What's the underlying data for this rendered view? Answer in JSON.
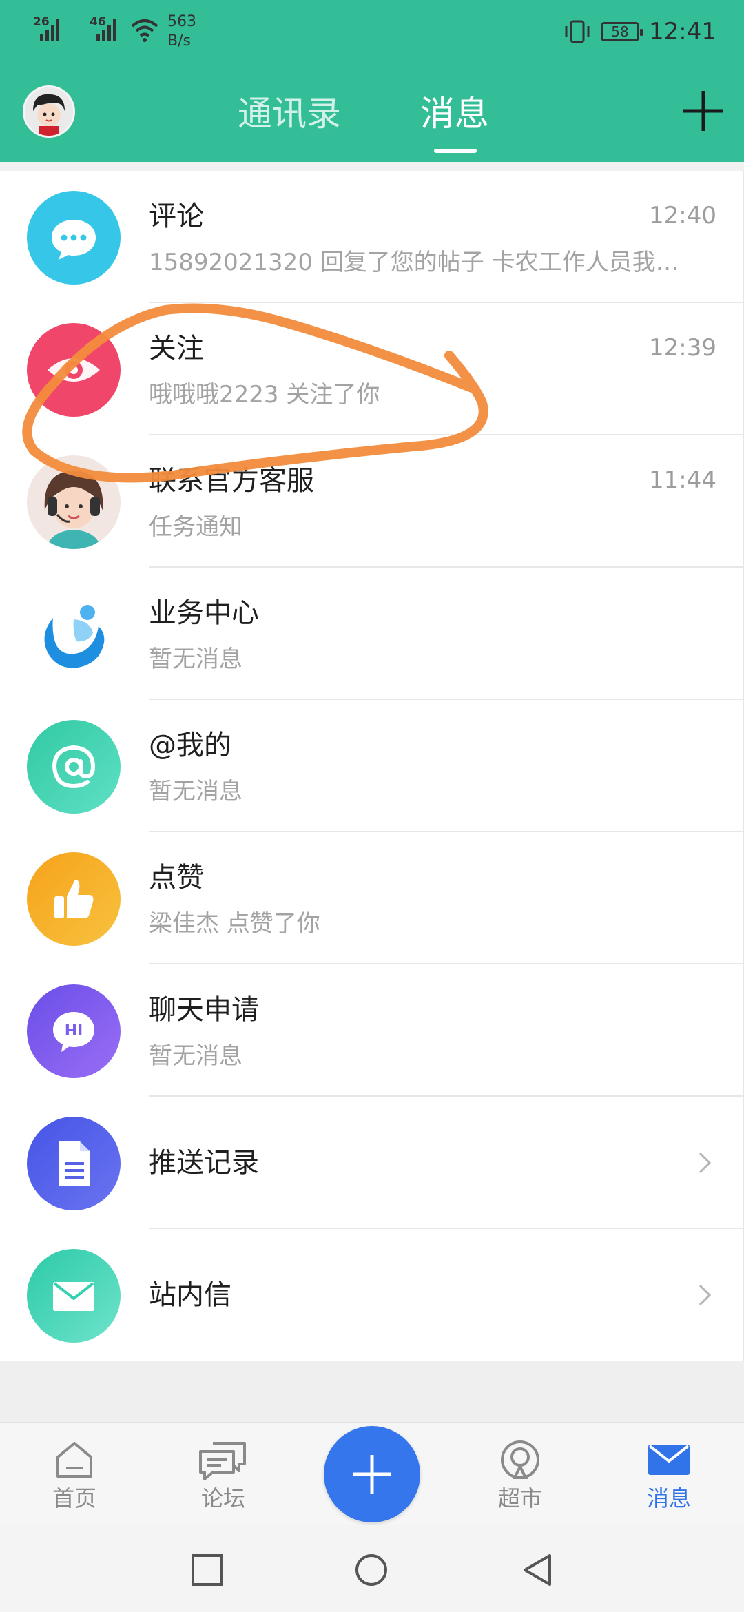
{
  "status_bar": {
    "signal1": "26",
    "signal2": "46",
    "net_speed_value": "563",
    "net_speed_unit": "B/s",
    "battery": "58",
    "time": "12:41"
  },
  "header": {
    "tab_contacts": "通讯录",
    "tab_messages": "消息",
    "active_tab": "消息"
  },
  "messages": [
    {
      "title": "评论",
      "subtitle": "15892021320 回复了您的帖子 卡农工作人员我…",
      "time": "12:40",
      "icon": "comment-bubble-icon",
      "color": "#35c6e8"
    },
    {
      "title": "关注",
      "subtitle": "哦哦哦2223 关注了你",
      "time": "12:39",
      "icon": "eye-icon",
      "color": "#f0466a"
    },
    {
      "title": "联系官方客服",
      "subtitle": "任务通知",
      "time": "11:44",
      "icon": "customer-service-avatar-icon",
      "color": "#e8e8e8"
    },
    {
      "title": "业务中心",
      "subtitle": "暂无消息",
      "time": "",
      "icon": "business-center-logo-icon",
      "color": "#1f8ee0"
    },
    {
      "title": "@我的",
      "subtitle": "暂无消息",
      "time": "",
      "icon": "at-icon",
      "color": "#2fc9a5"
    },
    {
      "title": "点赞",
      "subtitle": "梁佳杰 点赞了你",
      "time": "",
      "icon": "thumbs-up-icon",
      "color": "#f5a623"
    },
    {
      "title": "聊天申请",
      "subtitle": "暂无消息",
      "time": "",
      "icon": "hi-chat-icon",
      "color": "#7b5ef0"
    },
    {
      "title": "推送记录",
      "subtitle": "",
      "time": "",
      "icon": "document-icon",
      "color": "#5461e8"
    },
    {
      "title": "站内信",
      "subtitle": "",
      "time": "",
      "icon": "mail-icon",
      "color": "#35d0b0"
    }
  ],
  "bottom_nav": {
    "home": "首页",
    "forum": "论坛",
    "market": "超市",
    "messages": "消息",
    "active": "消息"
  },
  "colors": {
    "header": "#33be98",
    "accent_blue": "#3576ec",
    "annotation": "#f28c3c"
  }
}
